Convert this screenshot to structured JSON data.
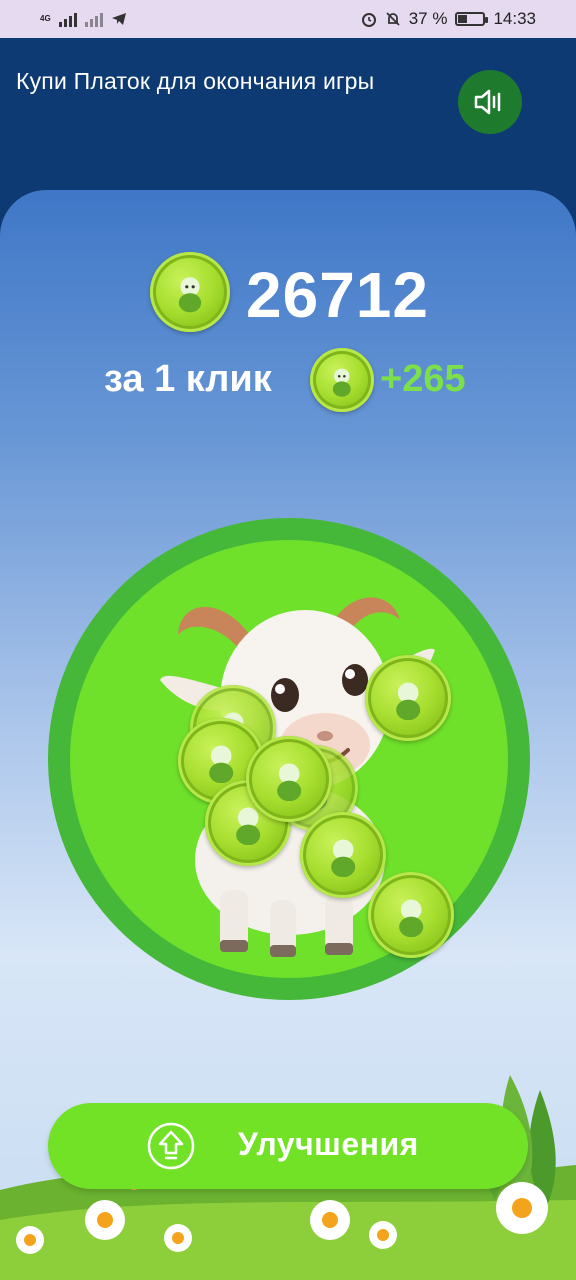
{
  "status_bar": {
    "network_label": "4G",
    "battery_percent": "37 %",
    "battery_level": 0.37,
    "time": "14:33",
    "icons": [
      "signal-icon",
      "no-signal-icon",
      "telegram-icon",
      "alarm-icon",
      "mute-bell-icon",
      "battery-icon"
    ]
  },
  "header": {
    "title": "Купи Платок для окончания игры",
    "sound_icon": "speaker-icon"
  },
  "game": {
    "balance": "26712",
    "per_click_label": "за 1 клик",
    "per_click_value": "+265",
    "coin_icon": "goat-coin-icon",
    "click_target_icon": "goat-icon"
  },
  "upgrade": {
    "label": "Улучшения",
    "icon": "arrow-up-circle-icon"
  },
  "colors": {
    "header_bg": "#0d3a73",
    "button_green": "#72e227",
    "accent_green": "#7be04a",
    "sound_button": "#1e7b2e"
  }
}
